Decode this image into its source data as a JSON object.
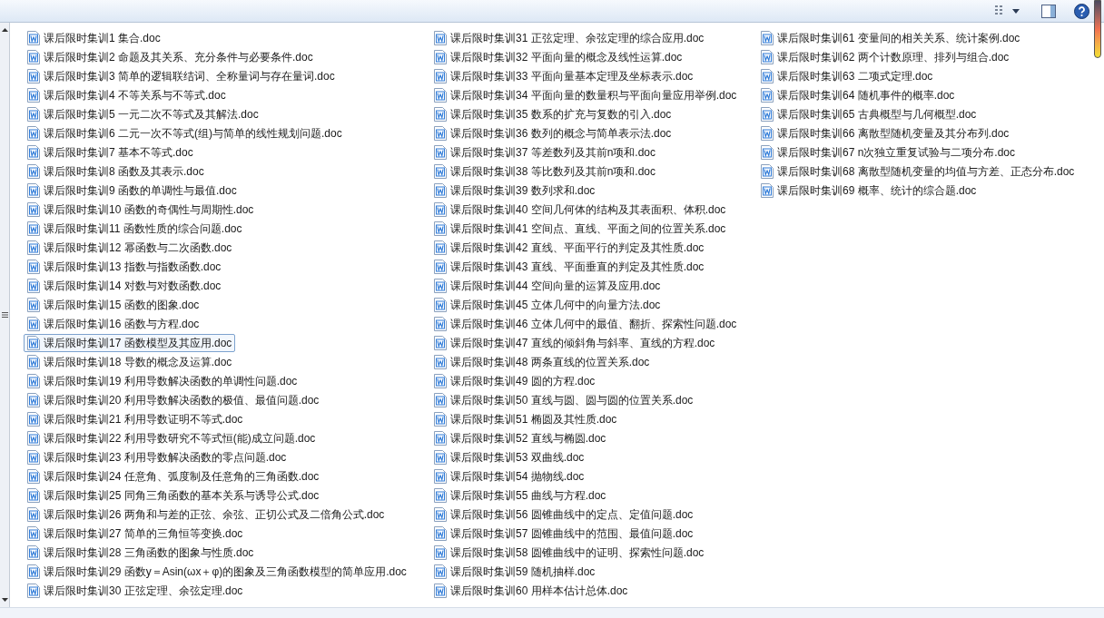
{
  "files": [
    {
      "name": "课后限时集训1 集合.doc",
      "selected": false
    },
    {
      "name": "课后限时集训2 命题及其关系、充分条件与必要条件.doc",
      "selected": false
    },
    {
      "name": "课后限时集训3 简单的逻辑联结词、全称量词与存在量词.doc",
      "selected": false
    },
    {
      "name": "课后限时集训4 不等关系与不等式.doc",
      "selected": false
    },
    {
      "name": "课后限时集训5 一元二次不等式及其解法.doc",
      "selected": false
    },
    {
      "name": "课后限时集训6 二元一次不等式(组)与简单的线性规划问题.doc",
      "selected": false
    },
    {
      "name": "课后限时集训7 基本不等式.doc",
      "selected": false
    },
    {
      "name": "课后限时集训8 函数及其表示.doc",
      "selected": false
    },
    {
      "name": "课后限时集训9 函数的单调性与最值.doc",
      "selected": false
    },
    {
      "name": "课后限时集训10 函数的奇偶性与周期性.doc",
      "selected": false
    },
    {
      "name": "课后限时集训11 函数性质的综合问题.doc",
      "selected": false
    },
    {
      "name": "课后限时集训12 幂函数与二次函数.doc",
      "selected": false
    },
    {
      "name": "课后限时集训13 指数与指数函数.doc",
      "selected": false
    },
    {
      "name": "课后限时集训14 对数与对数函数.doc",
      "selected": false
    },
    {
      "name": "课后限时集训15 函数的图象.doc",
      "selected": false
    },
    {
      "name": "课后限时集训16 函数与方程.doc",
      "selected": false
    },
    {
      "name": "课后限时集训17 函数模型及其应用.doc",
      "selected": true
    },
    {
      "name": "课后限时集训18 导数的概念及运算.doc",
      "selected": false
    },
    {
      "name": "课后限时集训19 利用导数解决函数的单调性问题.doc",
      "selected": false
    },
    {
      "name": "课后限时集训20 利用导数解决函数的极值、最值问题.doc",
      "selected": false
    },
    {
      "name": "课后限时集训21 利用导数证明不等式.doc",
      "selected": false
    },
    {
      "name": "课后限时集训22 利用导数研究不等式恒(能)成立问题.doc",
      "selected": false
    },
    {
      "name": "课后限时集训23 利用导数解决函数的零点问题.doc",
      "selected": false
    },
    {
      "name": "课后限时集训24 任意角、弧度制及任意角的三角函数.doc",
      "selected": false
    },
    {
      "name": "课后限时集训25 同角三角函数的基本关系与诱导公式.doc",
      "selected": false
    },
    {
      "name": "课后限时集训26 两角和与差的正弦、余弦、正切公式及二倍角公式.doc",
      "selected": false
    },
    {
      "name": "课后限时集训27 简单的三角恒等变换.doc",
      "selected": false
    },
    {
      "name": "课后限时集训28 三角函数的图象与性质.doc",
      "selected": false
    },
    {
      "name": "课后限时集训29 函数y＝Asin(ωx＋φ)的图象及三角函数模型的简单应用.doc",
      "selected": false
    },
    {
      "name": "课后限时集训30 正弦定理、余弦定理.doc",
      "selected": false
    },
    {
      "name": "课后限时集训31 正弦定理、余弦定理的综合应用.doc",
      "selected": false
    },
    {
      "name": "课后限时集训32 平面向量的概念及线性运算.doc",
      "selected": false
    },
    {
      "name": "课后限时集训33 平面向量基本定理及坐标表示.doc",
      "selected": false
    },
    {
      "name": "课后限时集训34 平面向量的数量积与平面向量应用举例.doc",
      "selected": false
    },
    {
      "name": "课后限时集训35 数系的扩充与复数的引入.doc",
      "selected": false
    },
    {
      "name": "课后限时集训36 数列的概念与简单表示法.doc",
      "selected": false
    },
    {
      "name": "课后限时集训37 等差数列及其前n项和.doc",
      "selected": false
    },
    {
      "name": "课后限时集训38 等比数列及其前n项和.doc",
      "selected": false
    },
    {
      "name": "课后限时集训39 数列求和.doc",
      "selected": false
    },
    {
      "name": "课后限时集训40 空间几何体的结构及其表面积、体积.doc",
      "selected": false
    },
    {
      "name": "课后限时集训41 空间点、直线、平面之间的位置关系.doc",
      "selected": false
    },
    {
      "name": "课后限时集训42 直线、平面平行的判定及其性质.doc",
      "selected": false
    },
    {
      "name": "课后限时集训43 直线、平面垂直的判定及其性质.doc",
      "selected": false
    },
    {
      "name": "课后限时集训44 空间向量的运算及应用.doc",
      "selected": false
    },
    {
      "name": "课后限时集训45 立体几何中的向量方法.doc",
      "selected": false
    },
    {
      "name": "课后限时集训46 立体几何中的最值、翻折、探索性问题.doc",
      "selected": false
    },
    {
      "name": "课后限时集训47 直线的倾斜角与斜率、直线的方程.doc",
      "selected": false
    },
    {
      "name": "课后限时集训48 两条直线的位置关系.doc",
      "selected": false
    },
    {
      "name": "课后限时集训49 圆的方程.doc",
      "selected": false
    },
    {
      "name": "课后限时集训50 直线与圆、圆与圆的位置关系.doc",
      "selected": false
    },
    {
      "name": "课后限时集训51 椭圆及其性质.doc",
      "selected": false
    },
    {
      "name": "课后限时集训52 直线与椭圆.doc",
      "selected": false
    },
    {
      "name": "课后限时集训53 双曲线.doc",
      "selected": false
    },
    {
      "name": "课后限时集训54 抛物线.doc",
      "selected": false
    },
    {
      "name": "课后限时集训55 曲线与方程.doc",
      "selected": false
    },
    {
      "name": "课后限时集训56 圆锥曲线中的定点、定值问题.doc",
      "selected": false
    },
    {
      "name": "课后限时集训57 圆锥曲线中的范围、最值问题.doc",
      "selected": false
    },
    {
      "name": "课后限时集训58 圆锥曲线中的证明、探索性问题.doc",
      "selected": false
    },
    {
      "name": "课后限时集训59 随机抽样.doc",
      "selected": false
    },
    {
      "name": "课后限时集训60 用样本估计总体.doc",
      "selected": false
    },
    {
      "name": "课后限时集训61 变量间的相关关系、统计案例.doc",
      "selected": false
    },
    {
      "name": "课后限时集训62 两个计数原理、排列与组合.doc",
      "selected": false
    },
    {
      "name": "课后限时集训63 二项式定理.doc",
      "selected": false
    },
    {
      "name": "课后限时集训64 随机事件的概率.doc",
      "selected": false
    },
    {
      "name": "课后限时集训65 古典概型与几何概型.doc",
      "selected": false
    },
    {
      "name": "课后限时集训66 离散型随机变量及其分布列.doc",
      "selected": false
    },
    {
      "name": "课后限时集训67 n次独立重复试验与二项分布.doc",
      "selected": false
    },
    {
      "name": "课后限时集训68 离散型随机变量的均值与方差、正态分布.doc",
      "selected": false
    },
    {
      "name": "课后限时集训69 概率、统计的综合题.doc",
      "selected": false
    }
  ]
}
